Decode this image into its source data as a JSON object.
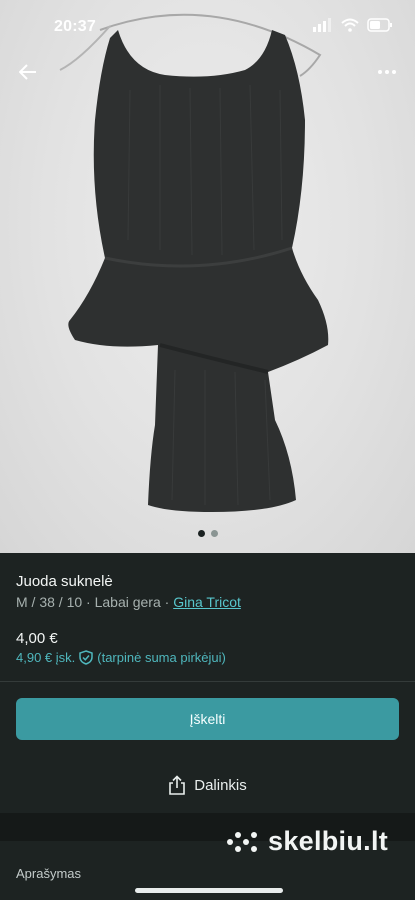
{
  "status": {
    "time": "20:37"
  },
  "listing": {
    "title": "Juoda suknelė",
    "meta_prefix": "M / 38 / 10 · Labai gera · ",
    "brand": "Gina Tricot",
    "price": "4,00 €",
    "price_incl": "4,90 € įsk.",
    "price_incl_note": "(tarpinė suma pirkėjui)"
  },
  "actions": {
    "buy_label": "Įškelti",
    "share_label": "Dalinkis"
  },
  "section": {
    "description_label": "Aprašymas"
  },
  "brand_logo": {
    "text": "skelbiu.lt"
  },
  "carousel": {
    "count": 2,
    "active_index": 0
  },
  "colors": {
    "accent": "#3b9aa1",
    "link": "#58c6cc",
    "background": "#1d2322"
  }
}
